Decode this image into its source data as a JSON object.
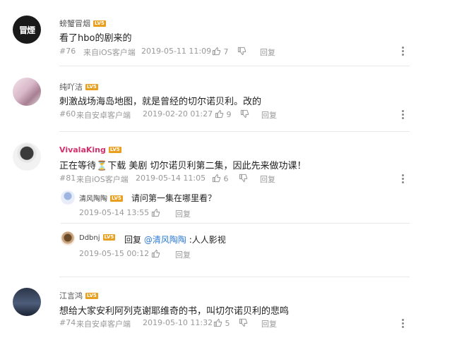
{
  "comments": [
    {
      "user": "螃蟹冒烟",
      "level": "LV5",
      "avatar_text": "冒煙",
      "text": "看了hbo的剧来的",
      "floor": "#76",
      "source": "来自iOS客户端",
      "time": "2019-05-11 11:09",
      "likes": "7",
      "reply": "回复"
    },
    {
      "user": "纯吖洁",
      "level": "LV5",
      "text": "刺激战场海岛地图，就是曾经的切尔诺贝利。改的",
      "floor": "#60",
      "source": "来自安卓客户端",
      "time": "2019-02-20 01:27",
      "likes": "9",
      "reply": "回复"
    },
    {
      "user": "VivalaKing",
      "level": "LV5",
      "text_before": "正在等待",
      "hourglass": "⏳",
      "text_after": "下载 美剧 切尔诺贝利第二集，因此先来做功课！",
      "floor": "#81",
      "source": "来自iOS客户端",
      "time": "2019-05-14 11:05",
      "likes": "6",
      "reply": "回复",
      "replies": [
        {
          "user": "清风陶陶",
          "level": "LV5",
          "text": "请问第一集在哪里看？",
          "time": "2019-05-14 13:55",
          "reply": "回复"
        },
        {
          "user": "Ddbnj",
          "level": "LV5",
          "prefix": "回复",
          "mention": "@清风陶陶",
          "text": ":人人影视",
          "time": "2019-05-15 00:12",
          "reply": "回复"
        }
      ]
    },
    {
      "user": "江言鸿",
      "level": "LV5",
      "text": "想给大家安利阿列克谢耶维奇的书，叫切尔诺贝利的悲鸣",
      "floor": "#74",
      "source": "来自安卓客户端",
      "time": "2019-05-10 11:32",
      "likes": "5",
      "reply": "回复"
    }
  ],
  "icons": {
    "like": "thumb-up-icon",
    "dislike": "thumb-down-icon",
    "more": "more-vertical-icon"
  },
  "colors": {
    "vip_name": "#d6316b",
    "level_badge": "#e9a020",
    "mention": "#2e7bd6"
  }
}
